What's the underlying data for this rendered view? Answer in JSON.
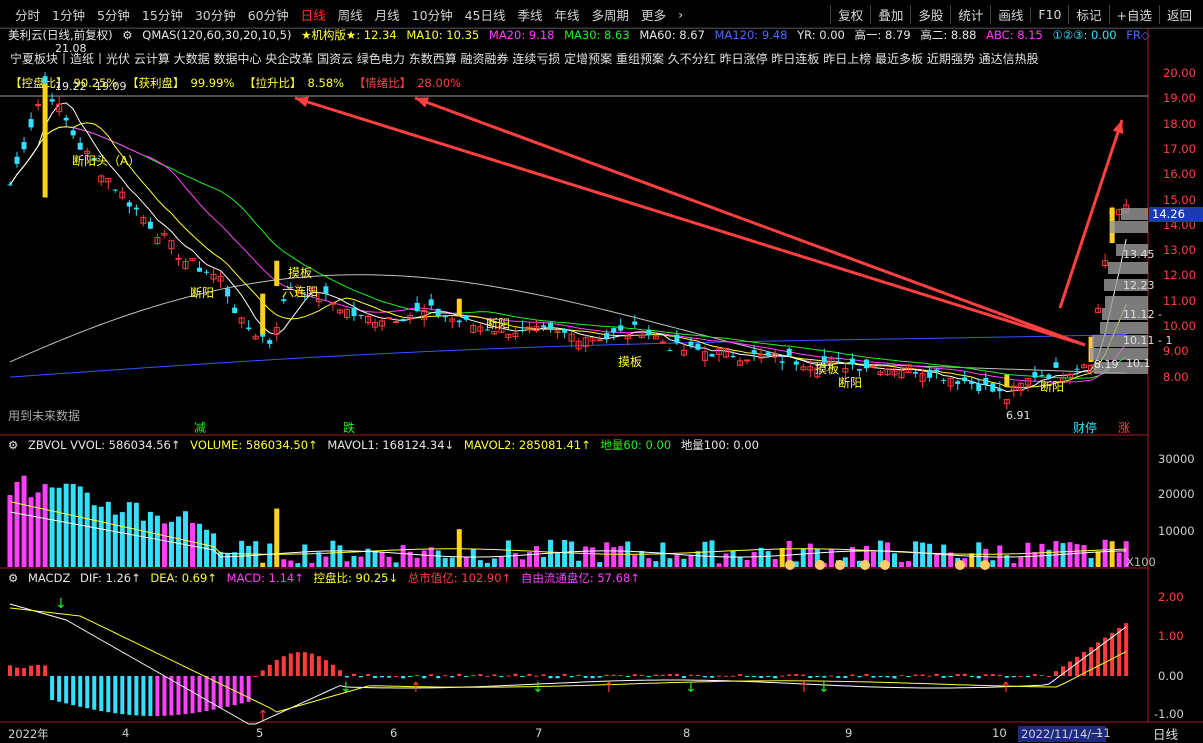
{
  "toolbar": {
    "periods": [
      "分时",
      "1分钟",
      "5分钟",
      "15分钟",
      "30分钟",
      "60分钟",
      "日线",
      "周线",
      "月线",
      "10分钟",
      "45日线",
      "季线",
      "年线",
      "多周期",
      "更多"
    ],
    "active": "日线",
    "right": [
      "复权",
      "叠加",
      "多股",
      "统计",
      "画线",
      "F10",
      "标记",
      "+自选",
      "返回"
    ]
  },
  "info": {
    "name": "美利云(日线,前复权)",
    "formula": "QMAS(120,60,30,20,10,5)",
    "inst": "★机构版★: 12.34",
    "ma10": "MA10: 10.35",
    "ma20": "MA20: 9.18",
    "ma30": "MA30: 8.63",
    "ma60": "MA60: 8.67",
    "ma120": "MA120: 9.48",
    "yr": "YR: 0.00",
    "h1": "高一: 8.79",
    "h2": "高二: 8.88",
    "abc": "ABC: 8.15",
    "circ": "①②③: 0.00",
    "fr": "FR◇"
  },
  "boards": "宁夏板块丨造纸丨光伏 云计算 大数据 数据中心 央企改革 国资云 绿色电力 东数西算 融资融券 连续亏损 定增预案 重组预案 久不分红 昨日涨停 昨日连板 昨日上榜 最近多板 近期强势 通达信热股",
  "stats": {
    "kongpan_k": "【控盘比】",
    "kongpan_v": "90.25%",
    "huoli_k": "【获利盘】",
    "huoli_v": "99.99%",
    "lasheng_k": "【拉升比】",
    "lasheng_v": "8.58%",
    "qingxu_k": "【情绪比】",
    "qingxu_v": "28.00%"
  },
  "main_annotations": {
    "peak": "21.08",
    "peak2": "19.22",
    "peak3": "19.09",
    "low": "6.91",
    "label_a": "断阳头（A）",
    "label_b": "摸板",
    "label_c": "六连阳",
    "label_d": "断阳",
    "label_e": "摸板",
    "label_f": "断阳",
    "label_g": "摸板",
    "label_h": "断阳",
    "label_i": "断阳",
    "future": "用到未来数据",
    "jian": "减",
    "die": "跌",
    "zhang": "涨",
    "caiting": "财停",
    "ma_now": "10.1",
    "ma_now2": "8.19"
  },
  "price_axis": [
    "20.00",
    "19.00",
    "18.00",
    "17.00",
    "16.00",
    "15.00",
    "14.00",
    "13.00",
    "12.00",
    "11.00",
    "10.00",
    "9.00",
    "8.00"
  ],
  "price_current": "14.26",
  "chip_labels": [
    "13.45",
    "12.23",
    "11.12 -",
    "10.11 - 1"
  ],
  "vol_panel": {
    "zbvol": "ZBVOL VVOL: 586034.56↑",
    "volume": "VOLUME: 586034.50↑",
    "mavol1": "MAVOL1: 168124.34↓",
    "mavol2": "MAVOL2: 285081.41↑",
    "dl60": "地量60: 0.00",
    "dl100": "地量100: 0.00",
    "axis": [
      "30000",
      "20000",
      "10000"
    ],
    "unit": "X100"
  },
  "macd_panel": {
    "name": "MACDZ",
    "dif": "DIF: 1.26↑",
    "dea": "DEA: 0.69↑",
    "macd": "MACD: 1.14↑",
    "kpb": "控盘比: 90.25↓",
    "zsz": "总市值亿: 102.90↑",
    "ltsz": "自由流通盘亿: 57.68↑",
    "axis": [
      "2.00",
      "1.00",
      "0.00",
      "-1.00"
    ]
  },
  "date_axis": [
    "2022年",
    "4",
    "5",
    "6",
    "7",
    "8",
    "9",
    "10",
    "2022/11/14/一",
    "11"
  ],
  "period_bottom": "日线",
  "colors": {
    "up": "#ff3b3b",
    "down": "#33e0ff",
    "ma5": "#ffffff",
    "ma10": "#ffff33",
    "ma20": "#ff40ff",
    "ma30": "#22ee22",
    "ma60": "#c0c0c0",
    "ma120": "#3355ff",
    "arrow": "#ff4040"
  }
}
